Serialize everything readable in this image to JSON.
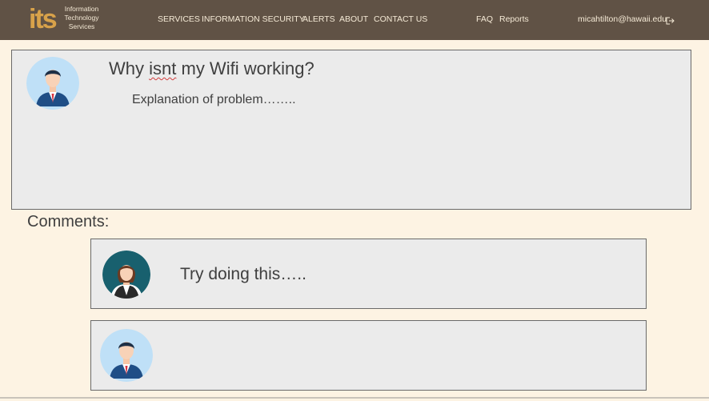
{
  "header": {
    "logo": {
      "mark": "its",
      "line1": "Information",
      "line2": "Technology",
      "line3": "Services"
    },
    "nav": [
      "SERVICES",
      "INFORMATION SECURITY",
      "ALERTS",
      "ABOUT",
      "CONTACT US"
    ],
    "secondary": [
      "FAQ",
      "Reports"
    ],
    "user_email": "micahtilton@hawaii.edu"
  },
  "post": {
    "title_before": "Why ",
    "title_misspelled": "isnt",
    "title_after": " my Wifi working?",
    "body": "Explanation of problem……..",
    "author_avatar": "male-user-avatar"
  },
  "comments_heading": "Comments:",
  "comments": [
    {
      "avatar": "female-user-avatar",
      "text": "Try doing this….."
    },
    {
      "avatar": "male-user-avatar",
      "text": ""
    }
  ],
  "colors": {
    "header_bg": "#605245",
    "page_bg": "#fdf3e3",
    "card_bg": "#ebebeb",
    "logo_accent": "#d8a24a"
  }
}
